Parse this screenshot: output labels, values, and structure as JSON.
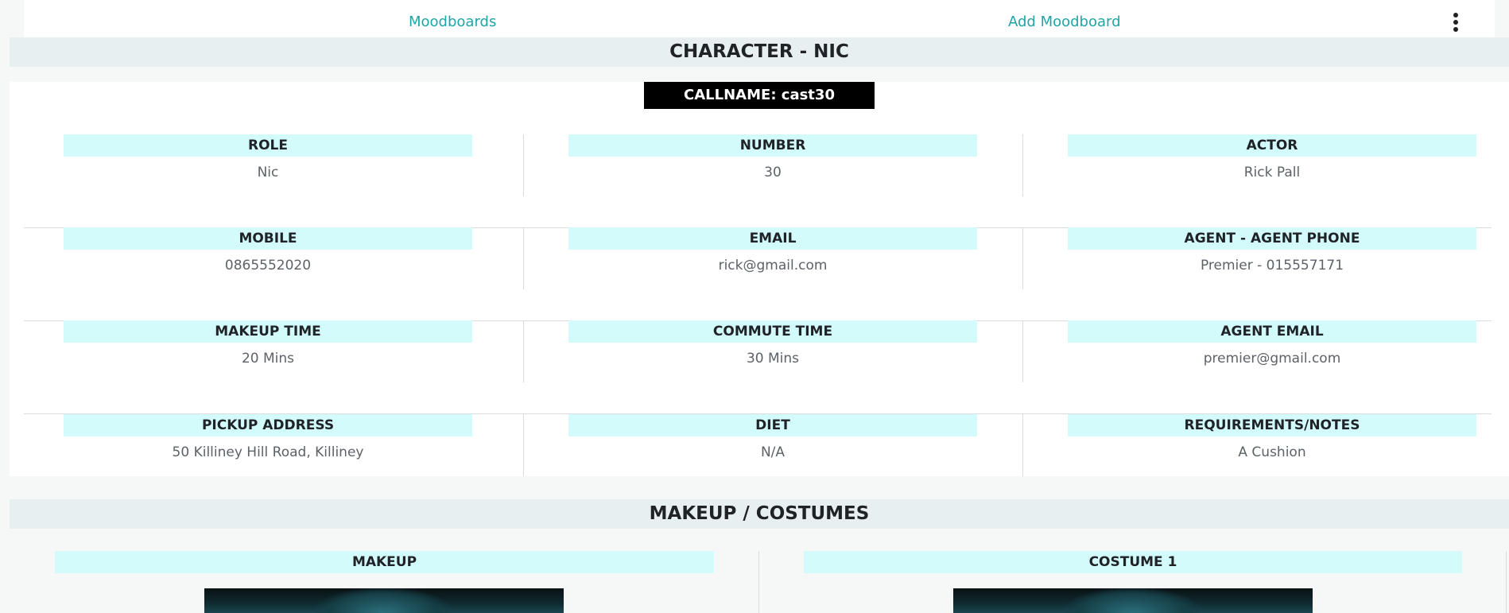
{
  "nav": {
    "moodboards_label": "Moodboards",
    "add_moodboard_label": "Add Moodboard",
    "more_icon": "kebab-vertical-icon"
  },
  "character": {
    "header": "CHARACTER - NIC",
    "callname": "CALLNAME: cast30",
    "rows": [
      [
        {
          "label": "ROLE",
          "value": "Nic"
        },
        {
          "label": "NUMBER",
          "value": "30"
        },
        {
          "label": "ACTOR",
          "value": "Rick Pall"
        }
      ],
      [
        {
          "label": "MOBILE",
          "value": "0865552020"
        },
        {
          "label": "EMAIL",
          "value": "rick@gmail.com"
        },
        {
          "label": "AGENT - AGENT PHONE",
          "value": "Premier - 015557171"
        }
      ],
      [
        {
          "label": "MAKEUP TIME",
          "value": "20 Mins"
        },
        {
          "label": "COMMUTE TIME",
          "value": "30 Mins"
        },
        {
          "label": "AGENT EMAIL",
          "value": "premier@gmail.com"
        }
      ],
      [
        {
          "label": "PICKUP ADDRESS",
          "value": "50 Killiney Hill Road, Killiney"
        },
        {
          "label": "DIET",
          "value": "N/A"
        },
        {
          "label": "REQUIREMENTS/NOTES",
          "value": "A Cushion"
        }
      ]
    ]
  },
  "makeup_costumes": {
    "header": "MAKEUP / COSTUMES",
    "makeup_label": "MAKEUP",
    "costume_label": "COSTUME 1"
  },
  "colors": {
    "accent": "#1fa5a5",
    "label_bg": "#d4fbfc",
    "section_bg": "#e8eff0"
  }
}
